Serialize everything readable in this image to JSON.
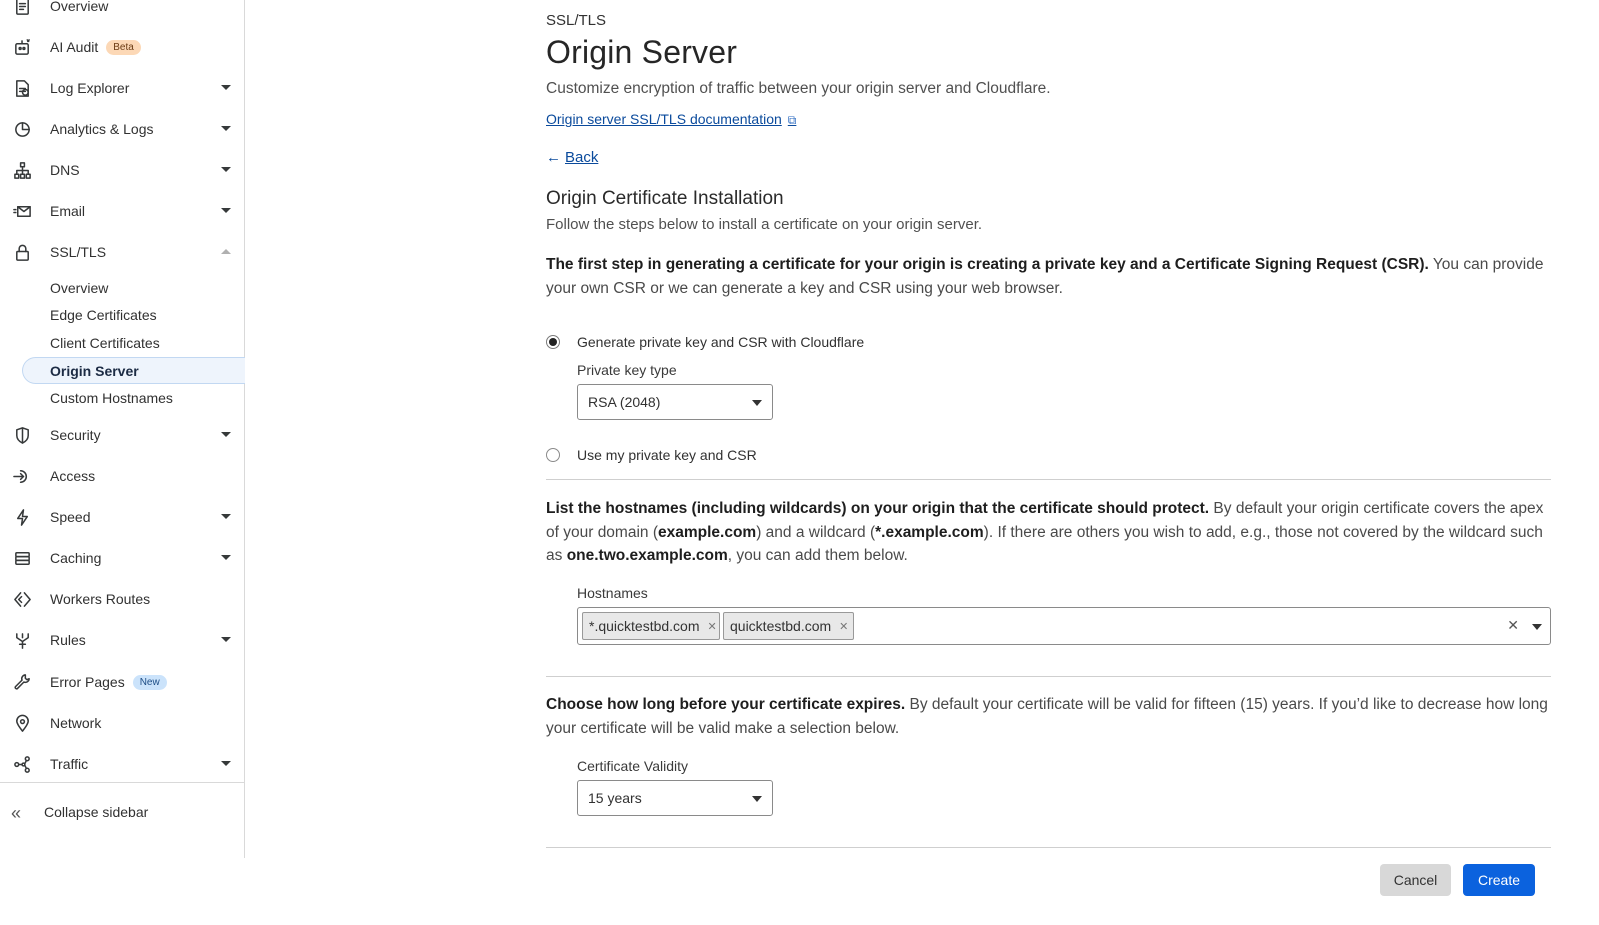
{
  "sidebar": {
    "items": [
      {
        "label": "Overview",
        "icon": "document-icon"
      },
      {
        "label": "AI Audit",
        "icon": "robot-icon",
        "badge": "Beta"
      },
      {
        "label": "Log Explorer",
        "icon": "log-file-icon"
      },
      {
        "label": "Analytics & Logs",
        "icon": "pie-chart-icon"
      },
      {
        "label": "DNS",
        "icon": "network-tree-icon"
      },
      {
        "label": "Email",
        "icon": "email-icon"
      },
      {
        "label": "SSL/TLS",
        "icon": "lock-icon"
      },
      {
        "label": "Security",
        "icon": "shield-icon"
      },
      {
        "label": "Access",
        "icon": "access-icon"
      },
      {
        "label": "Speed",
        "icon": "lightning-icon"
      },
      {
        "label": "Caching",
        "icon": "database-icon"
      },
      {
        "label": "Workers Routes",
        "icon": "workers-icon"
      },
      {
        "label": "Rules",
        "icon": "rules-icon"
      },
      {
        "label": "Error Pages",
        "icon": "wrench-icon",
        "badge": "New"
      },
      {
        "label": "Network",
        "icon": "location-pin-icon"
      },
      {
        "label": "Traffic",
        "icon": "traffic-icon"
      }
    ],
    "ssl_sub": [
      "Overview",
      "Edge Certificates",
      "Client Certificates",
      "Origin Server",
      "Custom Hostnames"
    ],
    "collapse_label": "Collapse sidebar"
  },
  "main": {
    "breadcrumb": "SSL/TLS",
    "title": "Origin Server",
    "subtitle": "Customize encryption of traffic between your origin server and Cloudflare.",
    "doc_link": "Origin server SSL/TLS documentation",
    "back_label": "Back",
    "section_title": "Origin Certificate Installation",
    "section_desc": "Follow the steps below to install a certificate on your origin server.",
    "step1_bold": "The first step in generating a certificate for your origin is creating a private key and a Certificate Signing Request (CSR).",
    "step1_rest": " You can provide your own CSR or we can generate a key and CSR using your web browser.",
    "radio_generate": "Generate private key and CSR with Cloudflare",
    "key_type_label": "Private key type",
    "key_type_value": "RSA (2048)",
    "radio_own": "Use my private key and CSR",
    "hosts_bold": "List the hostnames (including wildcards) on your origin that the certificate should protect.",
    "hosts_t1": " By default your origin certificate covers the apex of your domain (",
    "hosts_b2": "example.com",
    "hosts_t2": ") and a wildcard (",
    "hosts_b3": "*.example.com",
    "hosts_t3": "). If there are others you wish to add, e.g., those not covered by the wildcard such as ",
    "hosts_b4": "one.two.example.com",
    "hosts_t4": ", you can add them below.",
    "hostnames_label": "Hostnames",
    "hostname_tags": [
      "*.quicktestbd.com",
      "quicktestbd.com"
    ],
    "validity_bold": "Choose how long before your certificate expires.",
    "validity_rest": " By default your certificate will be valid for fifteen (15) years. If you’d like to decrease how long your certificate will be valid make a selection below.",
    "validity_label": "Certificate Validity",
    "validity_value": "15 years",
    "cancel_label": "Cancel",
    "create_label": "Create"
  }
}
